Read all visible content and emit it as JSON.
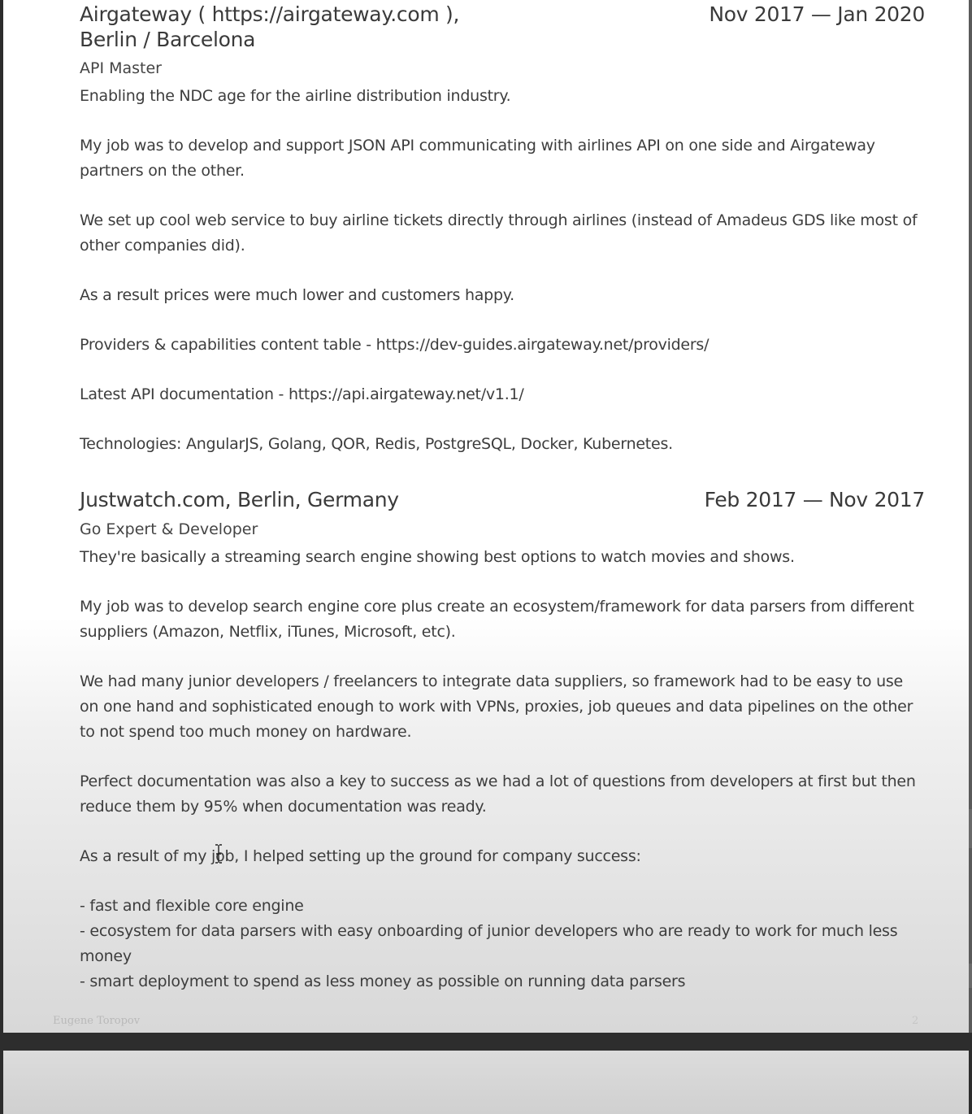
{
  "jobs": [
    {
      "company_line1": "Airgateway ( https://airgateway.com ),",
      "company_line2": "Berlin / Barcelona",
      "dates": "Nov 2017 — Jan 2020",
      "role": "API Master",
      "paragraphs": [
        "Enabling the NDC age for the airline distribution industry.",
        "My job was to develop and support JSON API communicating with airlines API on one side and Airgateway partners on the other.",
        "We set up cool web service to buy airline tickets directly through airlines (instead of Amadeus GDS like most of other companies did).",
        "As a result prices were much lower and customers happy.",
        "Providers & capabilities content table - https://dev-guides.airgateway.net/providers/",
        "Latest API documentation - https://api.airgateway.net/v1.1/",
        "Technologies: AngularJS, Golang, QOR, Redis, PostgreSQL, Docker, Kubernetes."
      ]
    },
    {
      "company_line1": "Justwatch.com, Berlin, Germany",
      "dates": "Feb 2017 — Nov 2017",
      "role": "Go Expert & Developer",
      "paragraphs": [
        "They're basically a streaming search engine showing best options to watch movies and shows.",
        "My job was to develop search engine core plus create an ecosystem/framework for data parsers from different suppliers (Amazon, Netflix, iTunes, Microsoft, etc).",
        "We had many junior developers / freelancers to integrate data suppliers, so framework had to be easy to use on one hand and sophisticated enough to work with VPNs, proxies, job queues and data pipelines on the other to not spend too much money on hardware.",
        "Perfect documentation was also a key to success as we had a lot of questions from developers at first but then reduce them by 95% when documentation was ready.",
        "As a result of my job, I helped setting up the ground for company success:"
      ],
      "bullets": [
        "- fast and flexible core engine",
        "- ecosystem for data parsers with easy onboarding of junior developers who are ready to work for much less money",
        "- smart deployment to spend as less money as possible on running data parsers"
      ]
    }
  ],
  "footer": {
    "author": "Eugene Toropov",
    "page_number": "2"
  },
  "cursor_icon": "text-cursor-icon"
}
